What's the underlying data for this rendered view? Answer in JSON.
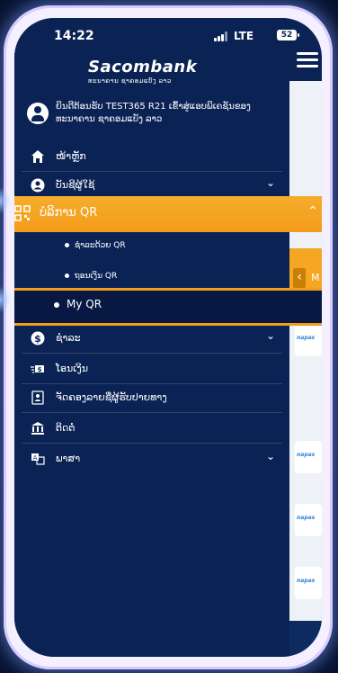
{
  "status": {
    "time": "14:22",
    "network": "LTE",
    "battery": "52"
  },
  "brand": {
    "name": "Sacombank",
    "subtitle": "ທະນາຄານ ຊາຄອມແບັງ ລາວ"
  },
  "user": {
    "greeting": "ຍິນດີຕ້ອນຮັບ TEST365 R21 ເຂົ້າສູ່ແອບພິເຄຊັນຂອງ ທະນາຄານ ຊາຄອມແບັງ ລາວ"
  },
  "menu": {
    "home": "ໜ້າຫຼັກ",
    "account": "ບັນຊີຜູ້ໃຊ້",
    "qr_service": "ບໍລິການ QR",
    "qr_sub": [
      "ຊຳລະດ້ວຍ QR",
      "ຖອນເງິນ QR"
    ],
    "my_qr": "My QR",
    "payment": "ຊຳລະ",
    "transfer": "ໂອນເງິນ",
    "beneficiary": "ຈັດຄອງລາຍຊື່ຜູ້ຮັບປາຍທາງ",
    "contact": "ຕິດຕໍ່",
    "language": "ພາສາ"
  },
  "right_panel": {
    "tag": "napas",
    "letter": "M"
  },
  "colors": {
    "accent": "#f39b1a",
    "drawer": "#0b2354"
  }
}
